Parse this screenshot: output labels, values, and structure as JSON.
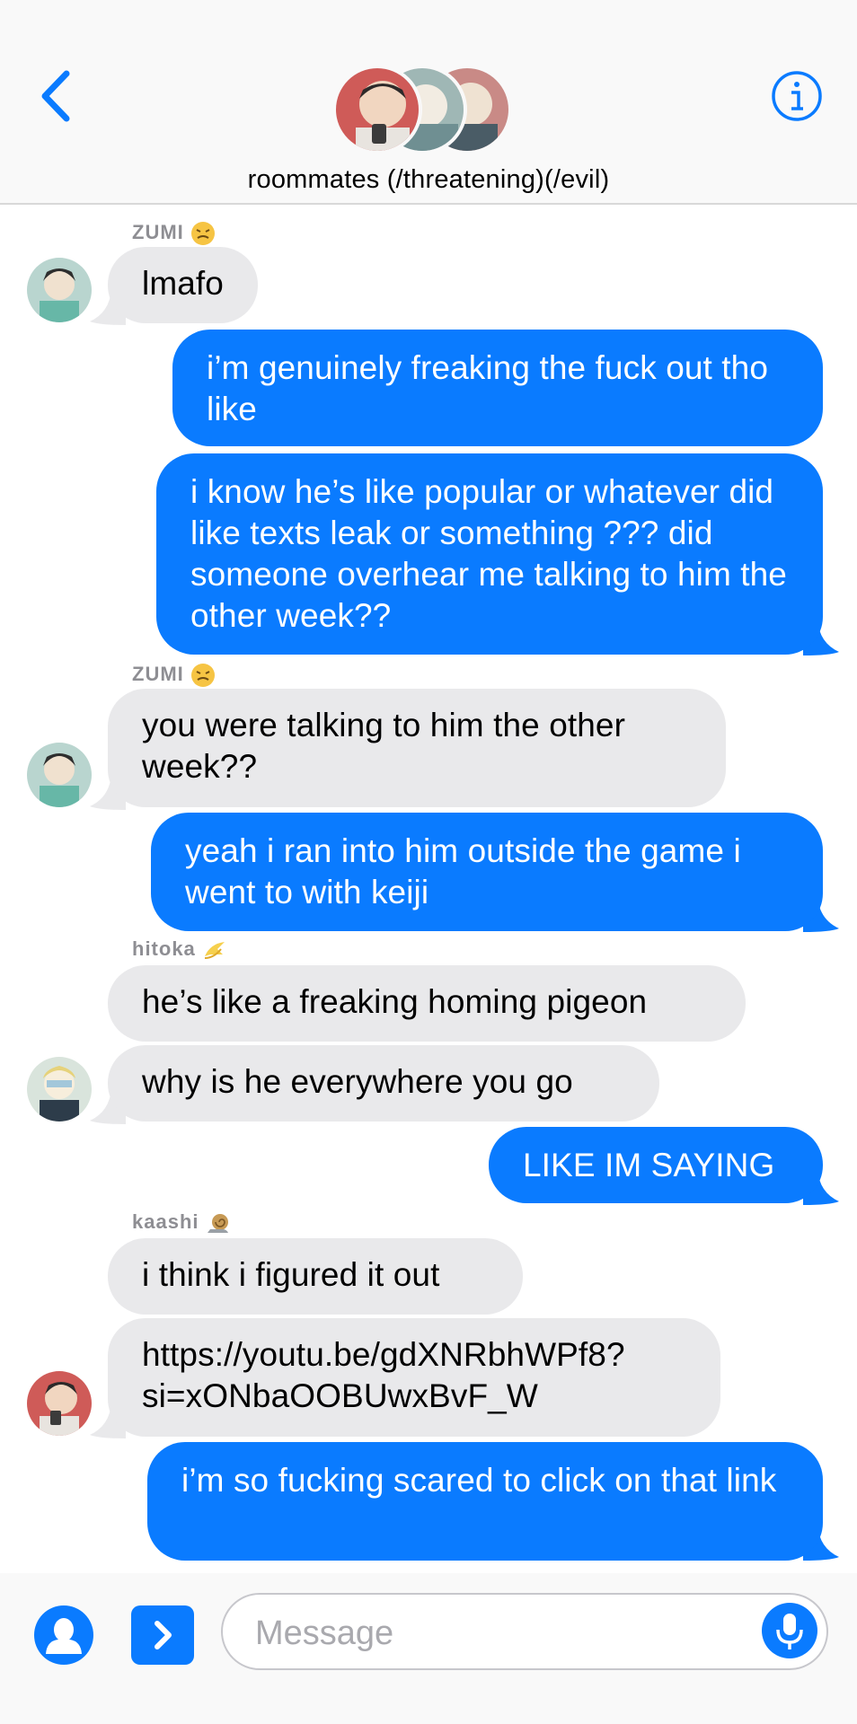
{
  "header": {
    "title": "roommates (/threatening)(/evil)"
  },
  "colors": {
    "accent": "#0a7bff",
    "incoming_bubble": "#e9e9eb",
    "outgoing_bubble": "#0a7bff",
    "sender_label": "#8e8e93"
  },
  "messages": [
    {
      "sender": "ZUMI",
      "sender_emoji": "steam-face-icon",
      "direction": "incoming",
      "text": "lmafo"
    },
    {
      "direction": "outgoing",
      "text": "i’m genuinely freaking the fuck out tho like"
    },
    {
      "direction": "outgoing",
      "text": "i know he’s like popular or whatever did like texts leak or something ??? did someone overhear me talking to him the other week??"
    },
    {
      "sender": "ZUMI",
      "sender_emoji": "steam-face-icon",
      "direction": "incoming",
      "text": "you were talking to him the other week??"
    },
    {
      "direction": "outgoing",
      "text": "yeah i ran into him outside the game i went to with keiji"
    },
    {
      "sender": "hitoka",
      "sender_emoji": "dizzy-icon",
      "direction": "incoming",
      "text": "he’s like a freaking homing pigeon"
    },
    {
      "direction": "incoming",
      "text": "why is he everywhere you go"
    },
    {
      "direction": "outgoing",
      "text": "LIKE IM SAYING"
    },
    {
      "sender": "kaashi",
      "sender_emoji": "snail-icon",
      "direction": "incoming",
      "text": "i think i figured it out"
    },
    {
      "direction": "incoming",
      "text": "https://youtu.be/gdXNRbhWPf8?si=xONbaOOBUwxBvF_W"
    },
    {
      "direction": "outgoing",
      "text": "i’m so fucking scared to click on that link"
    }
  ],
  "composer": {
    "placeholder": "Message"
  }
}
